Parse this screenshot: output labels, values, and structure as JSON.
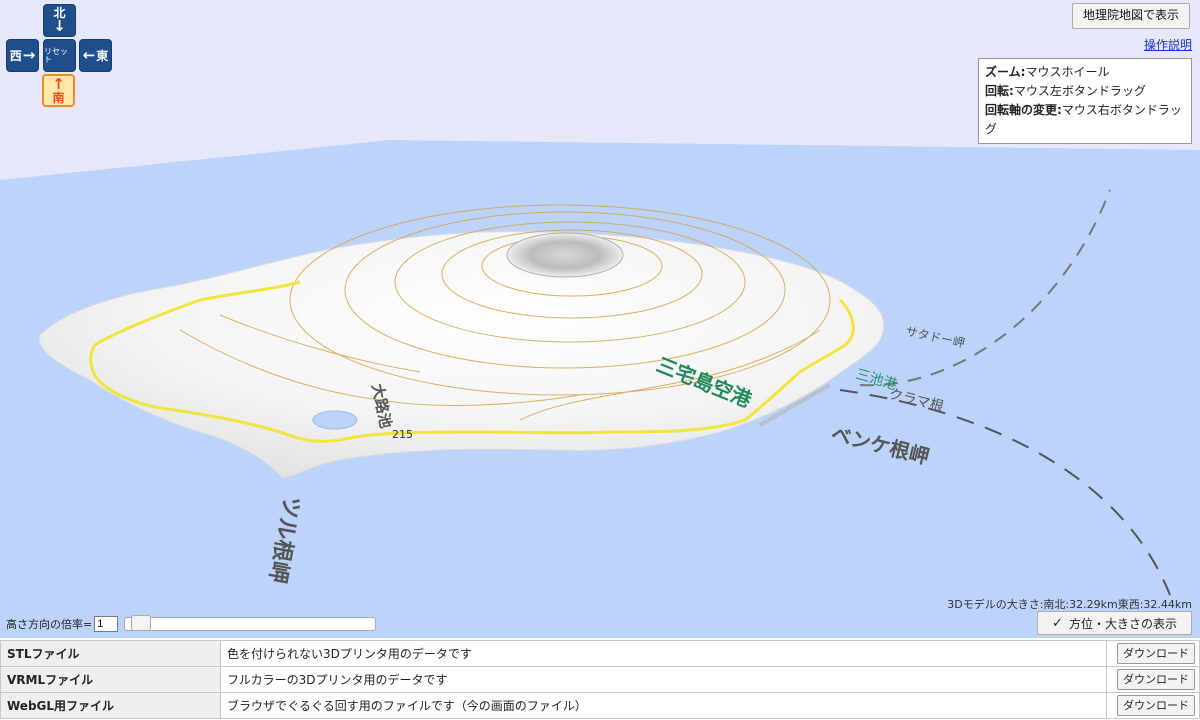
{
  "nav": {
    "north": {
      "label": "北",
      "arrow": "↓"
    },
    "west": {
      "label": "西",
      "arrow": "→"
    },
    "reset": {
      "label": "リセット"
    },
    "east": {
      "label": "東",
      "arrow": "←"
    },
    "south": {
      "label": "南",
      "arrow": "↑"
    }
  },
  "top_right": {
    "gsi_button": "地理院地図で表示",
    "help_link": "操作説明",
    "help": [
      {
        "key": "ズーム:",
        "value": "マウスホイール"
      },
      {
        "key": "回転:",
        "value": "マウス左ボタンドラッグ"
      },
      {
        "key": "回転軸の変更:",
        "value": "マウス右ボタンドラッグ"
      }
    ]
  },
  "map_labels": {
    "airport": "三宅島空港",
    "port": "三池港",
    "cape1": "ベンケ根岬",
    "cape2": "ツル根岬",
    "kurama": "クラマ根",
    "sataddo": "サタドー岬",
    "oji": "大路池",
    "route": "215"
  },
  "model_size": "3Dモデルの大きさ:南北:32.29km東西:32.44km",
  "show_button": "方位・大きさの表示",
  "check_icon": "✓",
  "height_label": "高さ方向の倍率=",
  "height_value": "1",
  "height_slider": {
    "min": 1,
    "max": 10,
    "value": 1
  },
  "files": [
    {
      "name": "STLファイル",
      "desc": "色を付けられない3Dプリンタ用のデータです",
      "button": "ダウンロード"
    },
    {
      "name": "VRMLファイル",
      "desc": "フルカラーの3Dプリンタ用のデータです",
      "button": "ダウンロード"
    },
    {
      "name": "WebGL用ファイル",
      "desc": "ブラウザでぐるぐる回す用のファイルです（今の画面のファイル）",
      "button": "ダウンロード"
    }
  ],
  "colors": {
    "sky": "#e6e7f9",
    "sea": "#bcd3fb",
    "road": "#f2e43a",
    "contour": "#d6a34a",
    "nav": "#1f4e8c",
    "nav_active": "#ffe9a8"
  }
}
